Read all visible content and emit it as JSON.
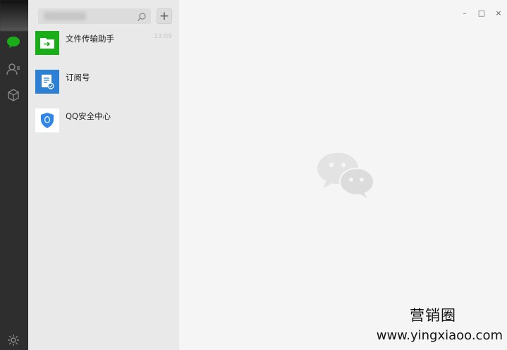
{
  "left_rail": {
    "icons": [
      "chat-icon",
      "contacts-icon",
      "favorites-icon",
      "settings-icon"
    ],
    "active_color": "#1aad19"
  },
  "search": {
    "add_label": "+"
  },
  "chats": [
    {
      "name": "文件传输助手",
      "time": "13:09",
      "icon": "file-transfer-icon",
      "color": "#1aad19"
    },
    {
      "name": "订阅号",
      "time": "",
      "icon": "subscription-icon",
      "color": "#2d7fd3"
    },
    {
      "name": "QQ安全中心",
      "time": "",
      "icon": "qq-security-icon",
      "color": "#2f86e8"
    }
  ],
  "window_controls": {
    "minimize": "–",
    "maximize": "□",
    "close": "×"
  },
  "overlay": {
    "brand": "营销圈",
    "site": "www.yingxiaoo.com"
  }
}
